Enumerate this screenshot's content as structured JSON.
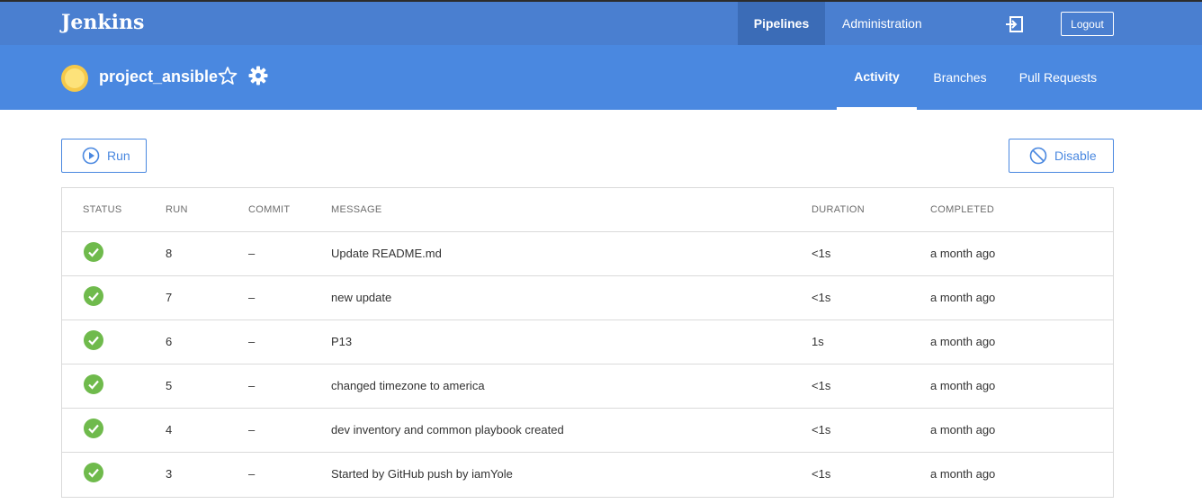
{
  "header": {
    "brand": "Jenkins",
    "nav": {
      "pipelines": "Pipelines",
      "administration": "Administration"
    },
    "logout_label": "Logout",
    "icons": {
      "login": "login-icon"
    }
  },
  "project": {
    "title": "project_ansible",
    "icons": {
      "status": "sunny-weather-icon",
      "favorite": "star-icon",
      "settings": "gear-icon"
    },
    "tabs": [
      "Activity",
      "Branches",
      "Pull Requests"
    ],
    "active_tab": "Activity"
  },
  "toolbar": {
    "run_label": "Run",
    "disable_label": "Disable"
  },
  "table": {
    "headers": [
      "STATUS",
      "RUN",
      "COMMIT",
      "MESSAGE",
      "DURATION",
      "COMPLETED"
    ],
    "rows": [
      {
        "status": "success",
        "run": "8",
        "commit": "–",
        "message": "Update README.md",
        "duration": "<1s",
        "completed": "a month ago"
      },
      {
        "status": "success",
        "run": "7",
        "commit": "–",
        "message": "new update",
        "duration": "<1s",
        "completed": "a month ago"
      },
      {
        "status": "success",
        "run": "6",
        "commit": "–",
        "message": "P13",
        "duration": "1s",
        "completed": "a month ago"
      },
      {
        "status": "success",
        "run": "5",
        "commit": "–",
        "message": "changed timezone to america",
        "duration": "<1s",
        "completed": "a month ago"
      },
      {
        "status": "success",
        "run": "4",
        "commit": "–",
        "message": "dev inventory and common playbook created",
        "duration": "<1s",
        "completed": "a month ago"
      },
      {
        "status": "success",
        "run": "3",
        "commit": "–",
        "message": "Started by GitHub push by iamYole",
        "duration": "<1s",
        "completed": "a month ago"
      }
    ]
  },
  "colors": {
    "header": "#4a7fd0",
    "subheader": "#4a88e0",
    "success": "#6fba4c",
    "accent": "#4a88e0"
  }
}
